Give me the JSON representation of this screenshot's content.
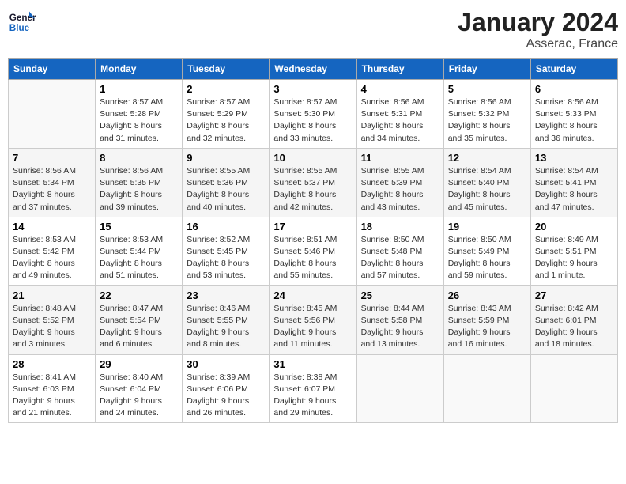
{
  "header": {
    "logo_line1": "General",
    "logo_line2": "Blue",
    "month": "January 2024",
    "location": "Asserac, France"
  },
  "weekdays": [
    "Sunday",
    "Monday",
    "Tuesday",
    "Wednesday",
    "Thursday",
    "Friday",
    "Saturday"
  ],
  "weeks": [
    [
      {
        "day": "",
        "info": ""
      },
      {
        "day": "1",
        "info": "Sunrise: 8:57 AM\nSunset: 5:28 PM\nDaylight: 8 hours\nand 31 minutes."
      },
      {
        "day": "2",
        "info": "Sunrise: 8:57 AM\nSunset: 5:29 PM\nDaylight: 8 hours\nand 32 minutes."
      },
      {
        "day": "3",
        "info": "Sunrise: 8:57 AM\nSunset: 5:30 PM\nDaylight: 8 hours\nand 33 minutes."
      },
      {
        "day": "4",
        "info": "Sunrise: 8:56 AM\nSunset: 5:31 PM\nDaylight: 8 hours\nand 34 minutes."
      },
      {
        "day": "5",
        "info": "Sunrise: 8:56 AM\nSunset: 5:32 PM\nDaylight: 8 hours\nand 35 minutes."
      },
      {
        "day": "6",
        "info": "Sunrise: 8:56 AM\nSunset: 5:33 PM\nDaylight: 8 hours\nand 36 minutes."
      }
    ],
    [
      {
        "day": "7",
        "info": "Sunrise: 8:56 AM\nSunset: 5:34 PM\nDaylight: 8 hours\nand 37 minutes."
      },
      {
        "day": "8",
        "info": "Sunrise: 8:56 AM\nSunset: 5:35 PM\nDaylight: 8 hours\nand 39 minutes."
      },
      {
        "day": "9",
        "info": "Sunrise: 8:55 AM\nSunset: 5:36 PM\nDaylight: 8 hours\nand 40 minutes."
      },
      {
        "day": "10",
        "info": "Sunrise: 8:55 AM\nSunset: 5:37 PM\nDaylight: 8 hours\nand 42 minutes."
      },
      {
        "day": "11",
        "info": "Sunrise: 8:55 AM\nSunset: 5:39 PM\nDaylight: 8 hours\nand 43 minutes."
      },
      {
        "day": "12",
        "info": "Sunrise: 8:54 AM\nSunset: 5:40 PM\nDaylight: 8 hours\nand 45 minutes."
      },
      {
        "day": "13",
        "info": "Sunrise: 8:54 AM\nSunset: 5:41 PM\nDaylight: 8 hours\nand 47 minutes."
      }
    ],
    [
      {
        "day": "14",
        "info": "Sunrise: 8:53 AM\nSunset: 5:42 PM\nDaylight: 8 hours\nand 49 minutes."
      },
      {
        "day": "15",
        "info": "Sunrise: 8:53 AM\nSunset: 5:44 PM\nDaylight: 8 hours\nand 51 minutes."
      },
      {
        "day": "16",
        "info": "Sunrise: 8:52 AM\nSunset: 5:45 PM\nDaylight: 8 hours\nand 53 minutes."
      },
      {
        "day": "17",
        "info": "Sunrise: 8:51 AM\nSunset: 5:46 PM\nDaylight: 8 hours\nand 55 minutes."
      },
      {
        "day": "18",
        "info": "Sunrise: 8:50 AM\nSunset: 5:48 PM\nDaylight: 8 hours\nand 57 minutes."
      },
      {
        "day": "19",
        "info": "Sunrise: 8:50 AM\nSunset: 5:49 PM\nDaylight: 8 hours\nand 59 minutes."
      },
      {
        "day": "20",
        "info": "Sunrise: 8:49 AM\nSunset: 5:51 PM\nDaylight: 9 hours\nand 1 minute."
      }
    ],
    [
      {
        "day": "21",
        "info": "Sunrise: 8:48 AM\nSunset: 5:52 PM\nDaylight: 9 hours\nand 3 minutes."
      },
      {
        "day": "22",
        "info": "Sunrise: 8:47 AM\nSunset: 5:54 PM\nDaylight: 9 hours\nand 6 minutes."
      },
      {
        "day": "23",
        "info": "Sunrise: 8:46 AM\nSunset: 5:55 PM\nDaylight: 9 hours\nand 8 minutes."
      },
      {
        "day": "24",
        "info": "Sunrise: 8:45 AM\nSunset: 5:56 PM\nDaylight: 9 hours\nand 11 minutes."
      },
      {
        "day": "25",
        "info": "Sunrise: 8:44 AM\nSunset: 5:58 PM\nDaylight: 9 hours\nand 13 minutes."
      },
      {
        "day": "26",
        "info": "Sunrise: 8:43 AM\nSunset: 5:59 PM\nDaylight: 9 hours\nand 16 minutes."
      },
      {
        "day": "27",
        "info": "Sunrise: 8:42 AM\nSunset: 6:01 PM\nDaylight: 9 hours\nand 18 minutes."
      }
    ],
    [
      {
        "day": "28",
        "info": "Sunrise: 8:41 AM\nSunset: 6:03 PM\nDaylight: 9 hours\nand 21 minutes."
      },
      {
        "day": "29",
        "info": "Sunrise: 8:40 AM\nSunset: 6:04 PM\nDaylight: 9 hours\nand 24 minutes."
      },
      {
        "day": "30",
        "info": "Sunrise: 8:39 AM\nSunset: 6:06 PM\nDaylight: 9 hours\nand 26 minutes."
      },
      {
        "day": "31",
        "info": "Sunrise: 8:38 AM\nSunset: 6:07 PM\nDaylight: 9 hours\nand 29 minutes."
      },
      {
        "day": "",
        "info": ""
      },
      {
        "day": "",
        "info": ""
      },
      {
        "day": "",
        "info": ""
      }
    ]
  ]
}
